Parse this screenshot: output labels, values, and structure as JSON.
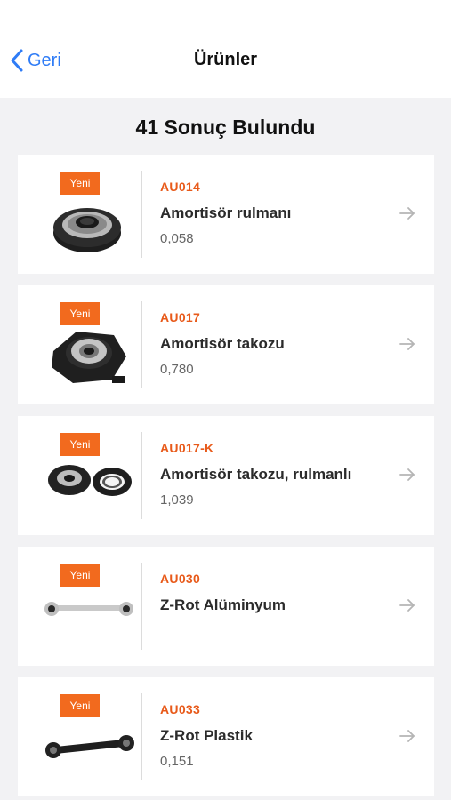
{
  "nav": {
    "back_label": "Geri",
    "title": "Ürünler"
  },
  "results": {
    "title": "41 Sonuç Bulundu"
  },
  "products": [
    {
      "badge": "Yeni",
      "code": "AU014",
      "name": "Amortisör rulmanı",
      "weight": "0,058",
      "image": "strut-bearing"
    },
    {
      "badge": "Yeni",
      "code": "AU017",
      "name": "Amortisör takozu",
      "weight": "0,780",
      "image": "strut-mount"
    },
    {
      "badge": "Yeni",
      "code": "AU017-K",
      "name": "Amortisör takozu, rulmanlı",
      "weight": "1,039",
      "image": "strut-mount-with-bearing"
    },
    {
      "badge": "Yeni",
      "code": "AU030",
      "name": "Z-Rot Alüminyum",
      "weight": "",
      "image": "aluminium-link-rod"
    },
    {
      "badge": "Yeni",
      "code": "AU033",
      "name": "Z-Rot Plastik",
      "weight": "0,151",
      "image": "plastic-link-rod"
    }
  ],
  "colors": {
    "accent": "#f26a1e",
    "code_text": "#e85a1a",
    "link_blue": "#2f7cf6",
    "background": "#f2f2f4"
  }
}
